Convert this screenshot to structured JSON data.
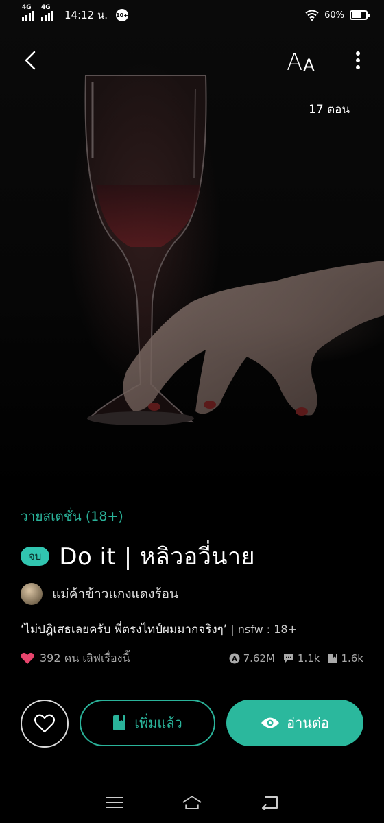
{
  "status_bar": {
    "network1": "4G",
    "network2": "4G",
    "time": "14:12 น.",
    "notification_count": "10+",
    "battery": "60%"
  },
  "nav": {
    "font_label_big": "A",
    "font_label_small": "A"
  },
  "episodes": "17 ตอน",
  "genre": "วายสเตชั่น (18+)",
  "end_badge": "จบ",
  "title": "Do it | หลิวอวี่นาย",
  "author": "แม่ค้าข้าวแกงแดงร้อน",
  "tagline": "‘ไม่ปฎิเสธเลยครับ พี่ตรงไทป์ผมมากจริงๆ’",
  "tagline_meta": " | nsfw : 18+",
  "likes_text": "392 คน เลิฟเรื่องนี้",
  "stats": {
    "views": "7.62M",
    "comments": "1.1k",
    "saves": "1.6k"
  },
  "buttons": {
    "added": "เพิ่มแล้ว",
    "read": "อ่านต่อ"
  },
  "colors": {
    "accent": "#2bb89d",
    "heart": "#e8456d"
  }
}
